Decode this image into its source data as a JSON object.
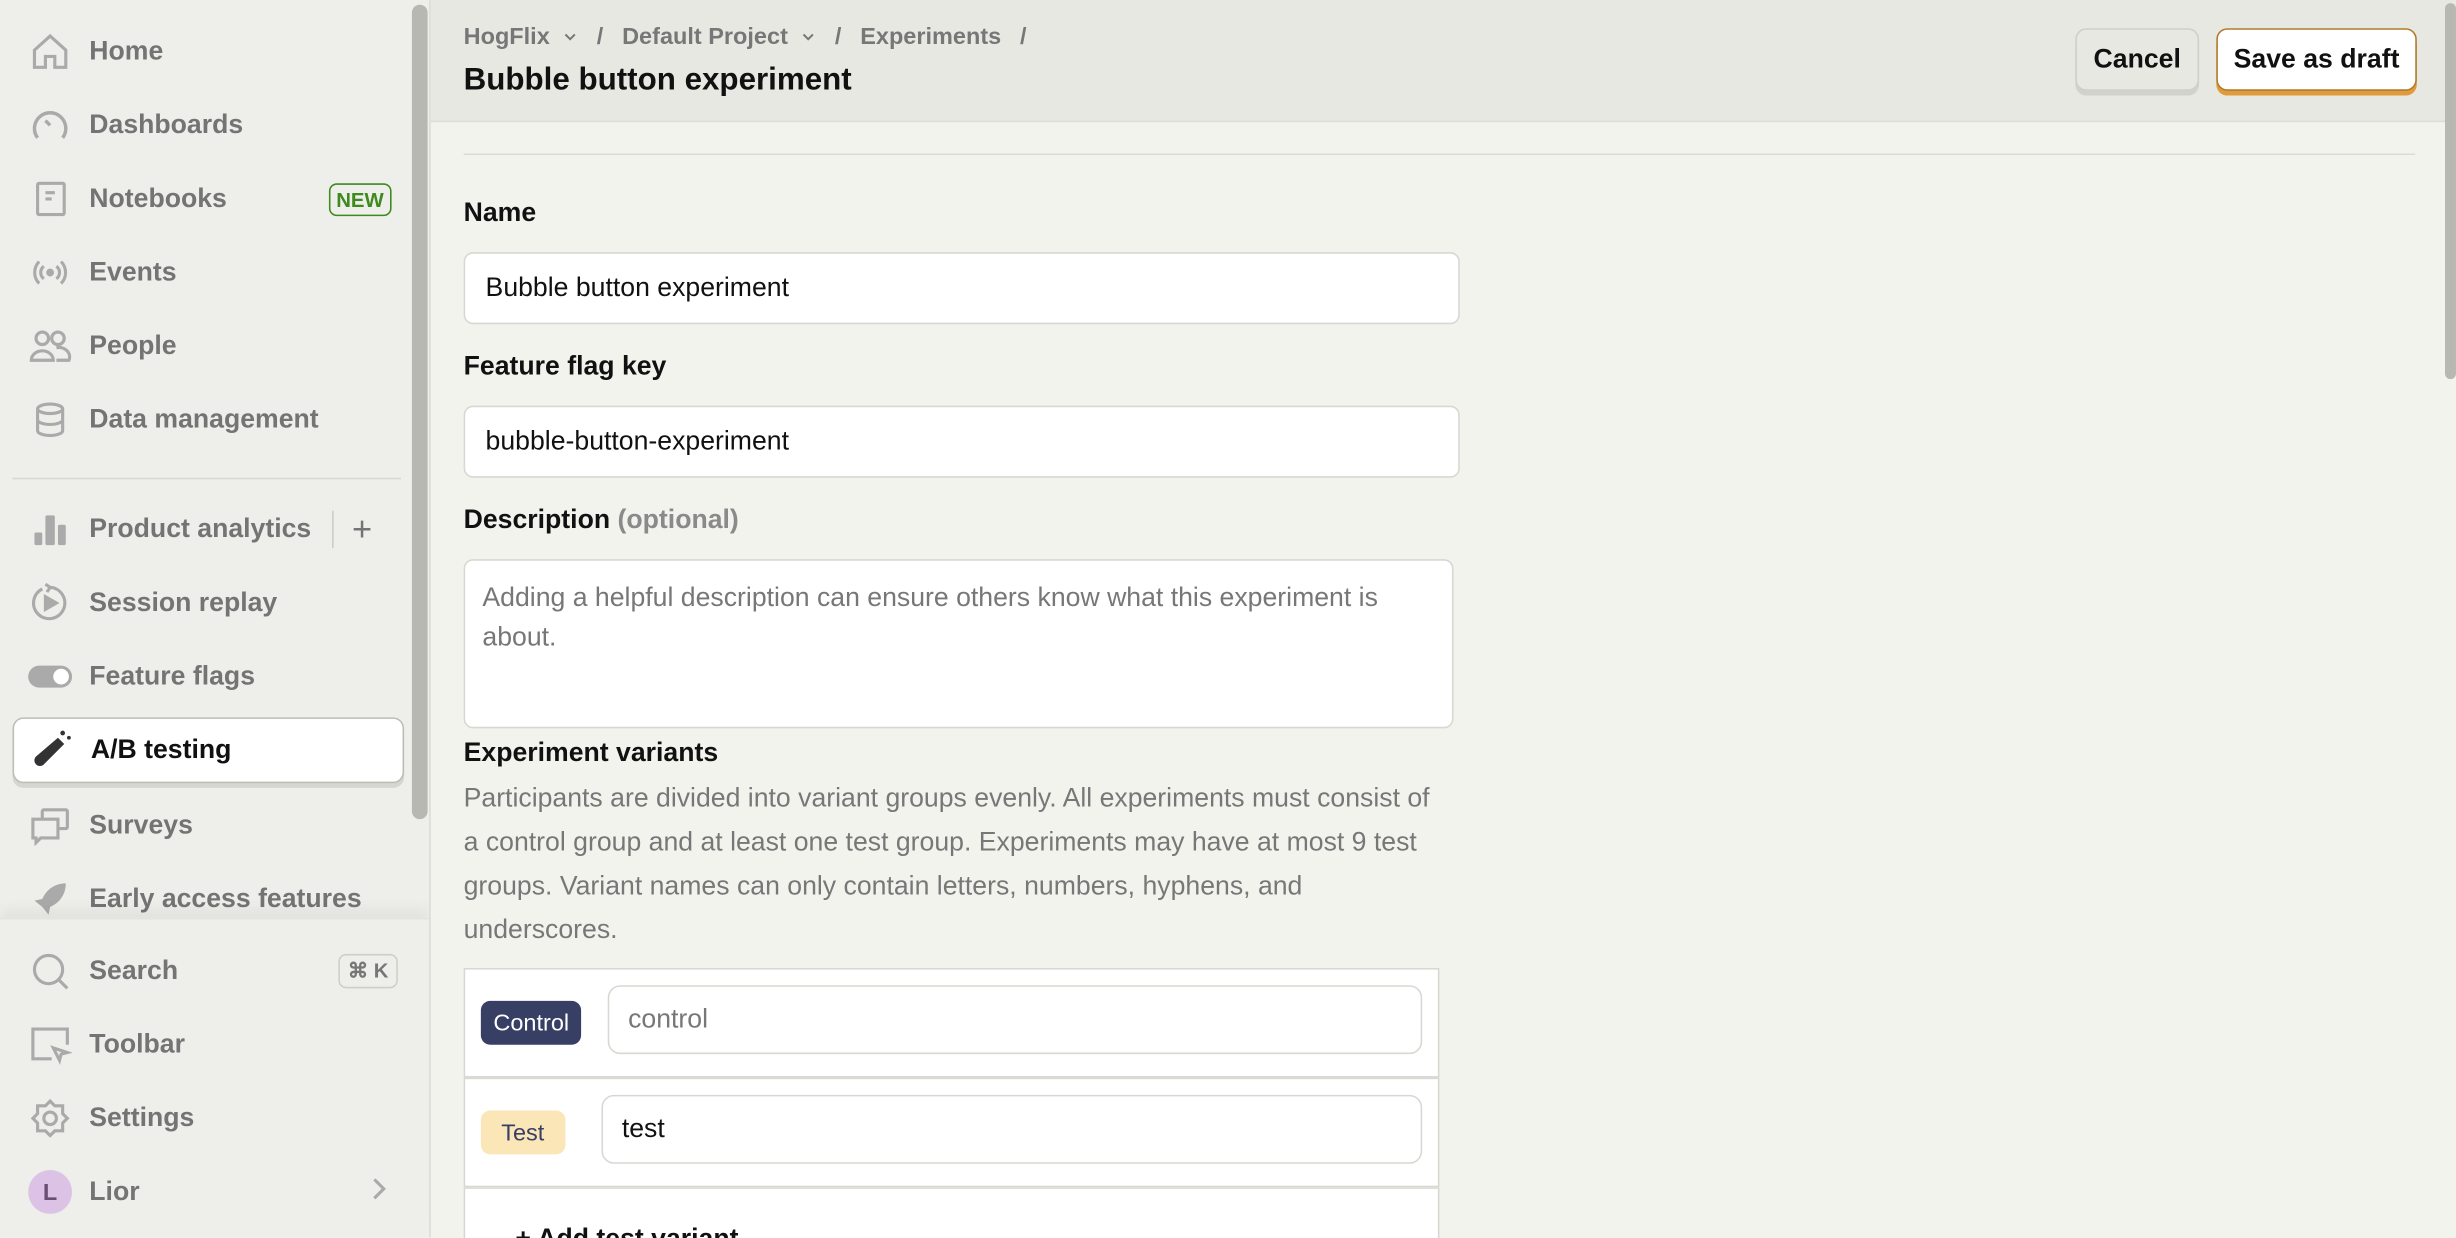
{
  "sidebar": {
    "items": [
      {
        "label": "Home",
        "icon": "home-icon"
      },
      {
        "label": "Dashboards",
        "icon": "gauge-icon"
      },
      {
        "label": "Notebooks",
        "icon": "notebook-icon",
        "badge": "NEW"
      },
      {
        "label": "Events",
        "icon": "broadcast-icon"
      },
      {
        "label": "People",
        "icon": "people-icon"
      },
      {
        "label": "Data management",
        "icon": "database-icon"
      },
      {
        "label": "Product analytics",
        "icon": "bar-chart-icon",
        "action": "+"
      },
      {
        "label": "Session replay",
        "icon": "replay-icon"
      },
      {
        "label": "Feature flags",
        "icon": "toggle-icon"
      },
      {
        "label": "A/B testing",
        "icon": "flask-icon",
        "active": true
      },
      {
        "label": "Surveys",
        "icon": "chat-icon"
      },
      {
        "label": "Early access features",
        "icon": "rocket-icon"
      }
    ],
    "bottom": [
      {
        "label": "Search",
        "icon": "search-icon",
        "shortcut": "⌘ K"
      },
      {
        "label": "Toolbar",
        "icon": "toolbar-icon"
      },
      {
        "label": "Settings",
        "icon": "gear-icon"
      },
      {
        "label": "Lior",
        "avatar": "L"
      }
    ]
  },
  "header": {
    "breadcrumbs": [
      "HogFlix",
      "Default Project",
      "Experiments"
    ],
    "title": "Bubble button experiment",
    "cancel": "Cancel",
    "save_draft": "Save as draft"
  },
  "form": {
    "name_label": "Name",
    "name_value": "Bubble button experiment",
    "flag_label": "Feature flag key",
    "flag_value": "bubble-button-experiment",
    "desc_label": "Description",
    "desc_optional": "(optional)",
    "desc_placeholder": "Adding a helpful description can ensure others know what this experiment is about.",
    "variants_label": "Experiment variants",
    "variants_help": "Participants are divided into variant groups evenly. All experiments must consist of a control group and at least one test group. Experiments may have at most 9 test groups. Variant names can only contain letters, numbers, hyphens, and underscores.",
    "variants": [
      {
        "tag": "Control",
        "value": "control"
      },
      {
        "tag": "Test",
        "value": "test"
      }
    ],
    "add_variant": "+ Add test variant"
  },
  "colors": {
    "accent": "#e09b3c",
    "control_tag": "#383f64",
    "test_tag": "#fbe6b7",
    "new_badge": "#3f8a1f"
  }
}
